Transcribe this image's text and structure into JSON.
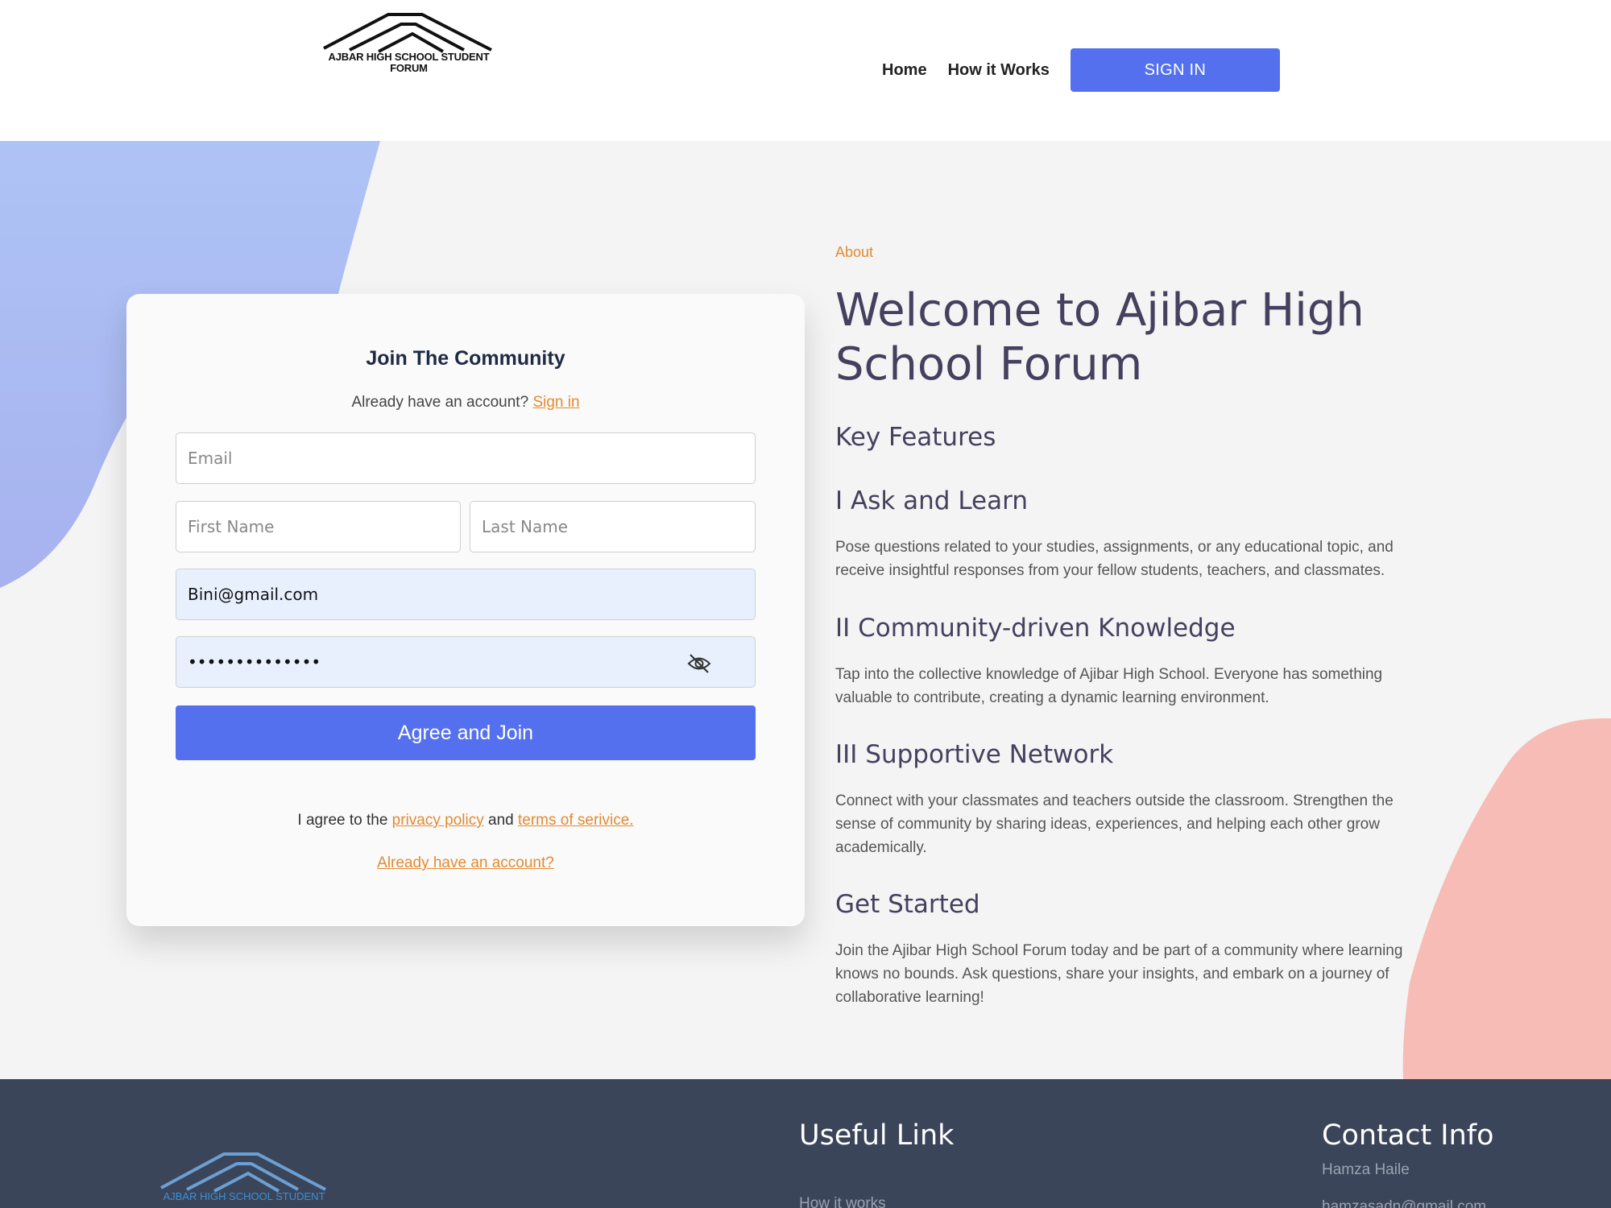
{
  "header": {
    "logo_text": "AJBAR HIGH SCHOOL STUDENT FORUM",
    "nav": {
      "home": "Home",
      "how_it_works": "How it Works"
    },
    "signin_label": "SIGN IN"
  },
  "form": {
    "title": "Join The Community",
    "already_prefix": "Already have an account?",
    "already_link": "Sign in",
    "email_placeholder": "Email",
    "first_name_placeholder": "First Name",
    "last_name_placeholder": "Last Name",
    "username_value": "Bini@gmail.com",
    "password_value": "••••••••••••••",
    "submit_label": "Agree and Join",
    "agree_prefix": "I agree to the",
    "privacy_link": "privacy policy",
    "and_text": "and",
    "terms_link": "terms of serivice.",
    "already_account_link": "Already have an account?"
  },
  "about": {
    "eyebrow": "About",
    "title": "Welcome to Ajibar High School Forum",
    "key_features": "Key Features",
    "features": [
      {
        "title": "I Ask and Learn",
        "text": "Pose questions related to your studies, assignments, or any educational topic, and receive insightful responses from your fellow students, teachers, and classmates."
      },
      {
        "title": "II Community-driven Knowledge",
        "text": "Tap into the collective knowledge of Ajibar High School. Everyone has something valuable to contribute, creating a dynamic learning environment."
      },
      {
        "title": "III Supportive Network",
        "text": "Connect with your classmates and teachers outside the classroom. Strengthen the sense of community by sharing ideas, experiences, and helping each other grow academically."
      },
      {
        "title": "Get Started",
        "text": "Join the Ajibar High School Forum today and be part of a community where learning knows no bounds. Ask questions, share your insights, and embark on a journey of collaborative learning!"
      }
    ]
  },
  "footer": {
    "logo_text": "AJBAR HIGH SCHOOL STUDENT",
    "useful_link_title": "Useful Link",
    "useful_link_item": "How it works",
    "contact_title": "Contact Info",
    "contact_name": "Hamza Haile",
    "contact_email": "hamzasadn@gmail.com"
  },
  "colors": {
    "primary": "#5470ee",
    "accent": "#e38a30",
    "heading": "#45405e",
    "footer_bg": "#3b4559"
  }
}
